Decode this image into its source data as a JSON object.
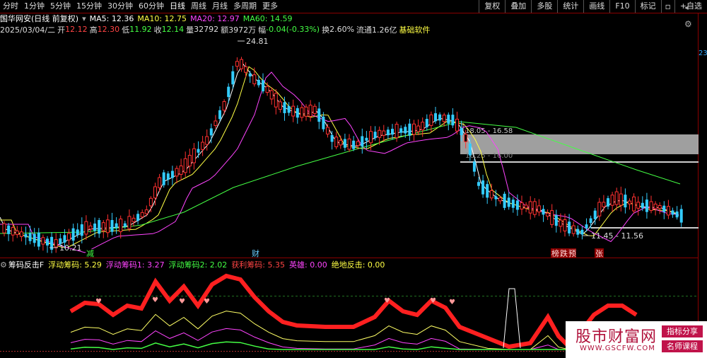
{
  "tabs": [
    "分时",
    "1分钟",
    "5分钟",
    "15分钟",
    "30分钟",
    "60分钟",
    "日线",
    "周线",
    "月线",
    "多周期",
    "更多"
  ],
  "active_tab": "日线",
  "right_buttons": [
    "复权",
    "叠加",
    "多股",
    "统计",
    "画线",
    "F10",
    "标记"
  ],
  "add_watch": "+自选",
  "stock_title": "国华网安(日线 前复权)",
  "ma": [
    {
      "label": "MA5: 12.36",
      "color": "#ffffff"
    },
    {
      "label": "MA10: 12.75",
      "color": "#ffff44"
    },
    {
      "label": "MA20: 12.97",
      "color": "#ff44ff"
    },
    {
      "label": "MA60: 14.59",
      "color": "#44ff44"
    }
  ],
  "quote": {
    "date": "2025/03/04/二",
    "open_l": "开",
    "open": "12.12",
    "high_l": "高",
    "high": "12.30",
    "low_l": "低",
    "low": "11.92",
    "close_l": "收",
    "close": "12.14",
    "vol_l": "量",
    "vol": "32792",
    "amt_l": "额",
    "amt": "3972万",
    "chg_l": "幅",
    "chg": "-0.04(-0.33%)",
    "turn_l": "换",
    "turn": "2.60%",
    "float_l": "流通",
    "float": "1.26亿",
    "info": "基础软件"
  },
  "annotations": {
    "high": "24.81",
    "low": "10.21",
    "low2": "11.45 - 11.56",
    "gap1": "18.05 - 16.58",
    "gap2": "16.25 - 16.00",
    "axis_tag": "23"
  },
  "event_tags": [
    {
      "label": "减",
      "color": "#44ff44"
    },
    {
      "label": "财",
      "color": "#66ccff"
    },
    {
      "label": "榜",
      "color": "#ff4444"
    },
    {
      "label": "跌",
      "color": "#ff4444"
    },
    {
      "label": "预",
      "color": "#ff4444"
    },
    {
      "label": "张",
      "color": "#ff4444"
    }
  ],
  "indicator": {
    "name": "筹码反击F",
    "items": [
      {
        "label": "浮动筹码: 5.29",
        "color": "#ffff44"
      },
      {
        "label": "浮动筹码1: 3.27",
        "color": "#ff44ff"
      },
      {
        "label": "浮动筹码2: 2.02",
        "color": "#44ff44"
      },
      {
        "label": "获利筹码: 5.35",
        "color": "#ff4444"
      },
      {
        "label": "英雄: 0.00",
        "color": "#ff44ff"
      },
      {
        "label": "绝地反击: 0.00",
        "color": "#ffff44"
      }
    ]
  },
  "watermark": {
    "title": "股市财富网",
    "url": "WWW.GSCFW.COM",
    "badge1": "指标分享",
    "badge2": "名师课程"
  },
  "colors": {
    "up": "#ff3030",
    "down": "#33ccff",
    "grid": "#8b0000",
    "bg": "#000000"
  }
}
